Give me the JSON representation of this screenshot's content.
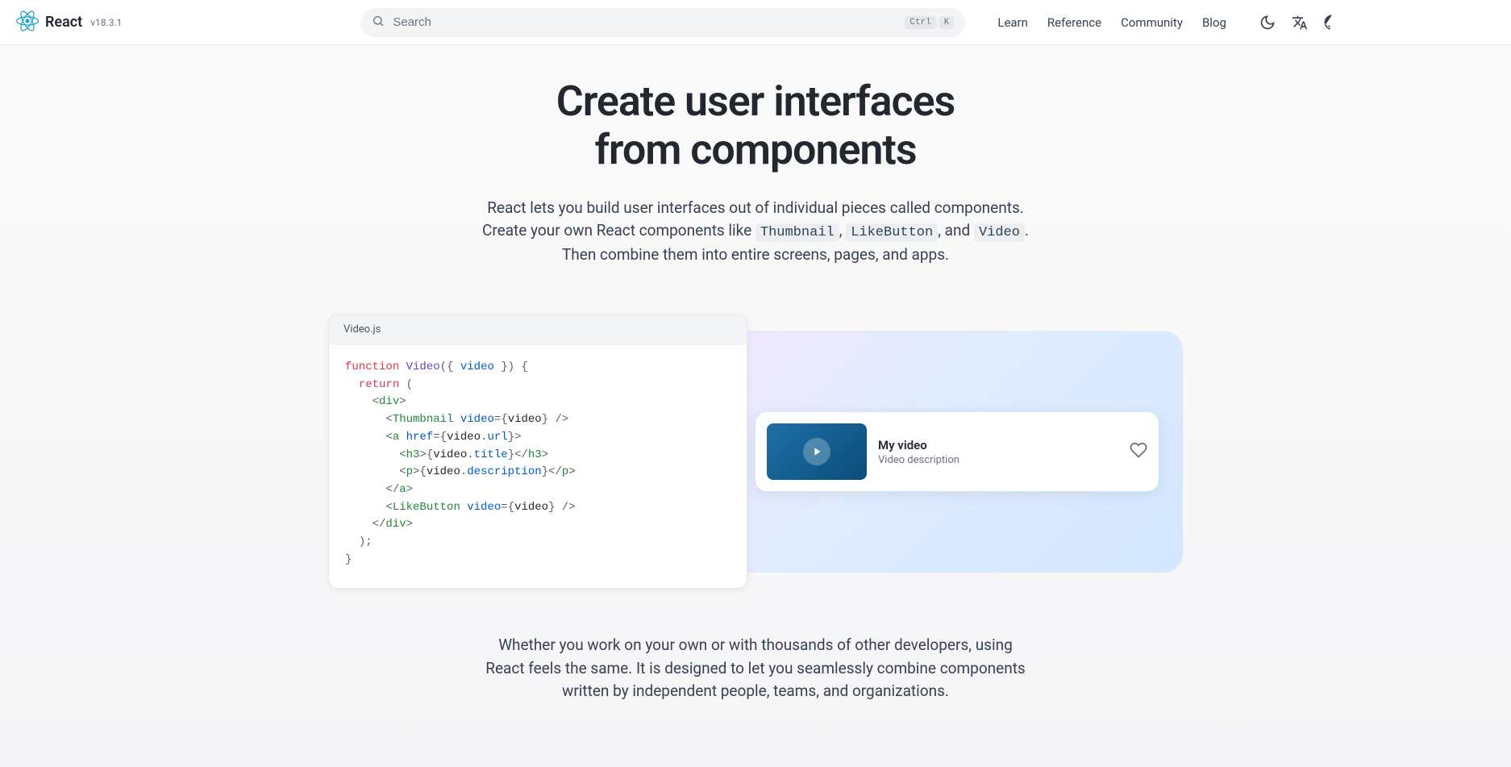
{
  "header": {
    "brand": "React",
    "version": "v18.3.1",
    "search_placeholder": "Search",
    "kbd_ctrl": "Ctrl",
    "kbd_k": "K",
    "nav": {
      "learn": "Learn",
      "reference": "Reference",
      "community": "Community",
      "blog": "Blog"
    }
  },
  "section": {
    "title_line1": "Create user interfaces",
    "title_line2": "from components",
    "lead_pre": "React lets you build user interfaces out of individual pieces called components. Create your own React components like ",
    "comp1": "Thumbnail",
    "comp_sep1": ", ",
    "comp2": "LikeButton",
    "comp_sep2": ", and ",
    "comp3": "Video",
    "lead_post": ". Then combine them into entire screens, pages, and apps.",
    "closing": "Whether you work on your own or with thousands of other developers, using React feels the same. It is designed to let you seamlessly combine components written by independent people, teams, and organizations."
  },
  "code": {
    "filename": "Video.js",
    "t": {
      "function": "function",
      "Video": "Video",
      "videoParam": "video",
      "return": "return",
      "div": "div",
      "Thumbnail": "Thumbnail",
      "a": "a",
      "href": "href",
      "url": "url",
      "h3": "h3",
      "title": "title",
      "p": "p",
      "description": "description",
      "LikeButton": "LikeButton",
      "videoAttr": "video"
    }
  },
  "preview": {
    "title": "My video",
    "desc": "Video description"
  }
}
